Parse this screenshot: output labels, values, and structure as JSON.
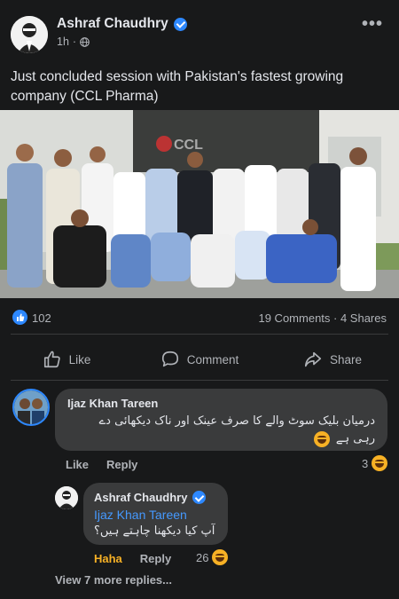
{
  "post": {
    "author": "Ashraf Chaudhry",
    "time": "1h",
    "privacy_icon": "globe-icon",
    "more_icon": "more-horizontal-icon",
    "text": "Just concluded session with Pakistan's fastest growing company (CCL Pharma)",
    "photo_sign": "CCL"
  },
  "stats": {
    "likes": "102",
    "comments_shares": "19 Comments · 4 Shares"
  },
  "actions": {
    "like": "Like",
    "comment": "Comment",
    "share": "Share"
  },
  "comments": [
    {
      "name": "Ijaz Khan Tareen",
      "text": "درمیان بلیک سوٹ والے کا صرف عینک اور ناک دیکھائی دے رہی ہے",
      "like": "Like",
      "reply": "Reply",
      "reactions": "3"
    },
    {
      "name": "Ashraf Chaudhry",
      "mention": "Ijaz Khan Tareen",
      "text": "آپ کیا دیکھنا چاہتے ہیں؟",
      "reaction_label": "Haha",
      "reply": "Reply",
      "reactions": "26"
    }
  ],
  "view_more": "View 7 more replies...",
  "colors": {
    "background": "#18191a",
    "bubble": "#3a3b3c",
    "accent": "#2d88ff",
    "haha": "#f7b125"
  }
}
